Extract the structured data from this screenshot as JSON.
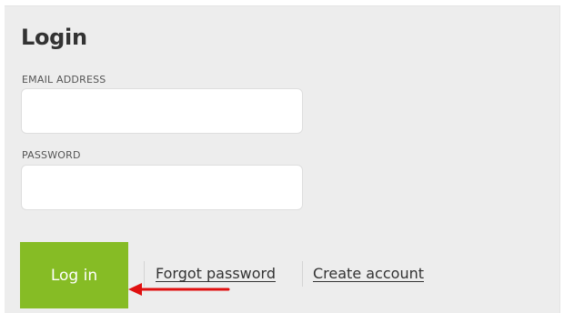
{
  "login_form": {
    "title": "Login",
    "email_label": "EMAIL ADDRESS",
    "email_value": "",
    "password_label": "PASSWORD",
    "password_value": "",
    "submit_label": "Log in",
    "forgot_password_label": "Forgot password",
    "create_account_label": "Create account"
  },
  "colors": {
    "panel_background": "#ededed",
    "button_background": "#86bc25",
    "button_text": "#ffffff",
    "annotation_arrow": "#e01010"
  },
  "icons": {
    "annotation": "red-arrow-icon"
  }
}
